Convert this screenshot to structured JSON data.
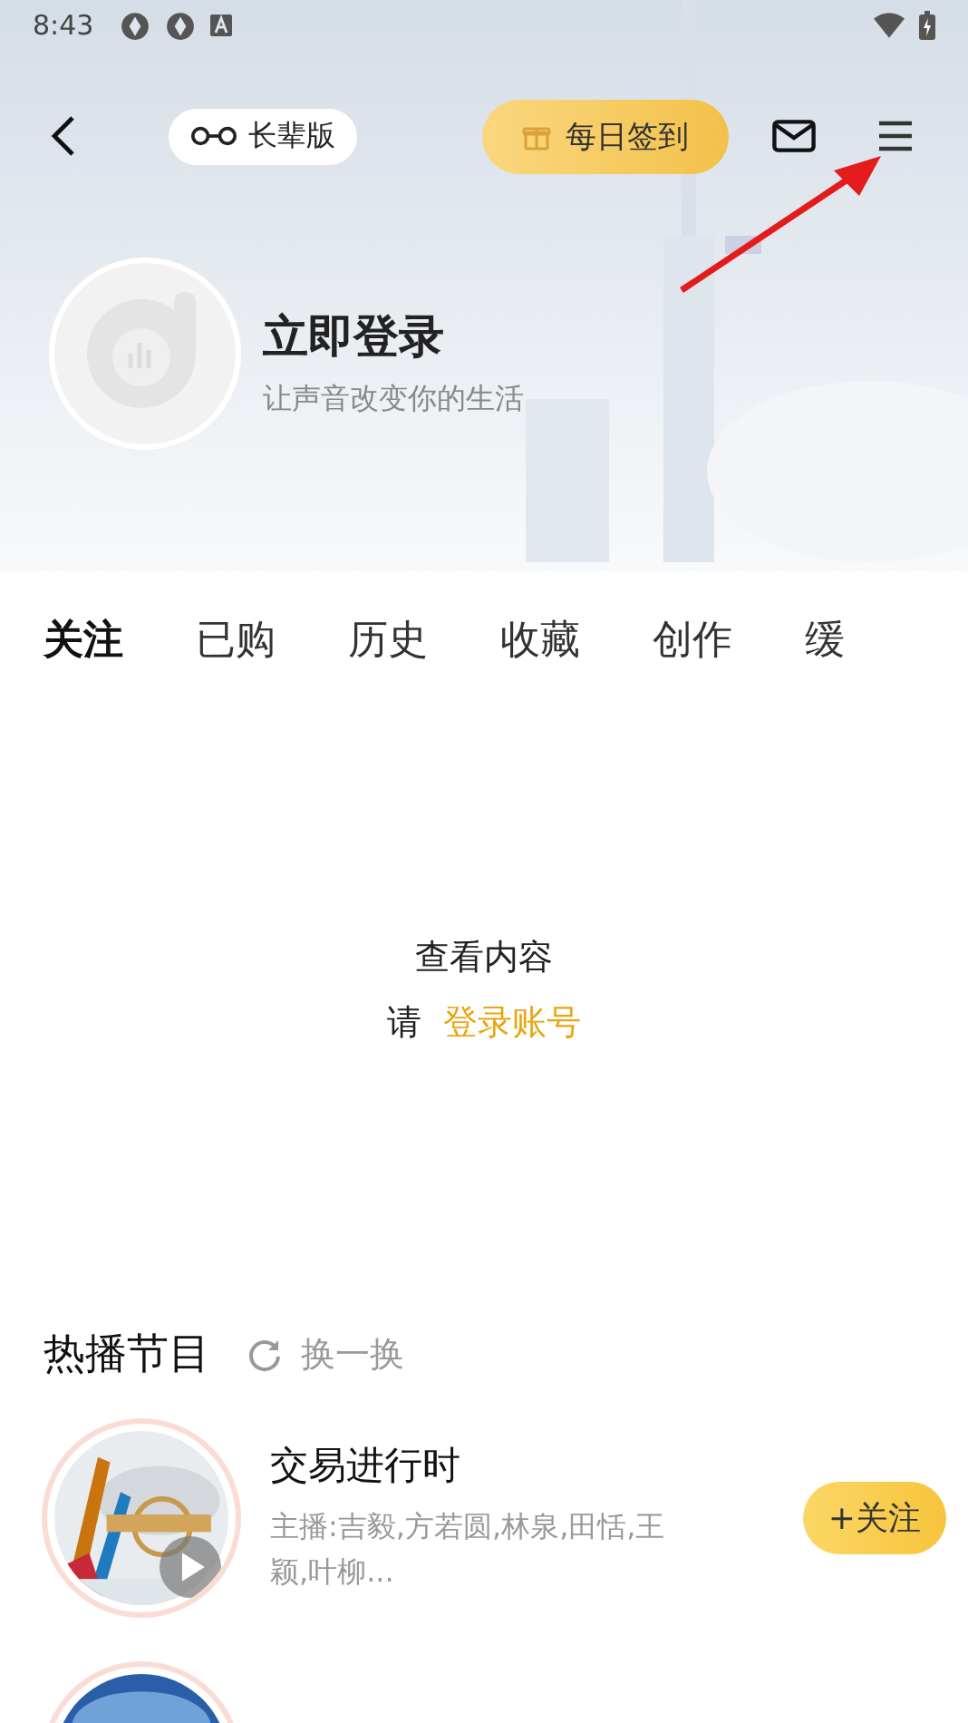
{
  "status_bar": {
    "time": "8:43"
  },
  "nav": {
    "elder_mode": "长辈版",
    "checkin": "每日签到"
  },
  "profile": {
    "title": "立即登录",
    "subtitle": "让声音改变你的生活"
  },
  "tabs": [
    {
      "label": "关注",
      "selected": true
    },
    {
      "label": "已购",
      "selected": false
    },
    {
      "label": "历史",
      "selected": false
    },
    {
      "label": "收藏",
      "selected": false
    },
    {
      "label": "创作",
      "selected": false
    },
    {
      "label": "缓",
      "selected": false
    }
  ],
  "empty": {
    "title": "查看内容",
    "prompt": "请",
    "link": "登录账号"
  },
  "hot": {
    "title": "热播节目",
    "refresh": "换一换",
    "programs": [
      {
        "kind": "full",
        "title": "交易进行时",
        "hosts": "主播:吉毅,方若圆,林泉,田恬,王颖,叶柳...",
        "follow": "+关注"
      },
      {
        "kind": "cut"
      }
    ]
  }
}
